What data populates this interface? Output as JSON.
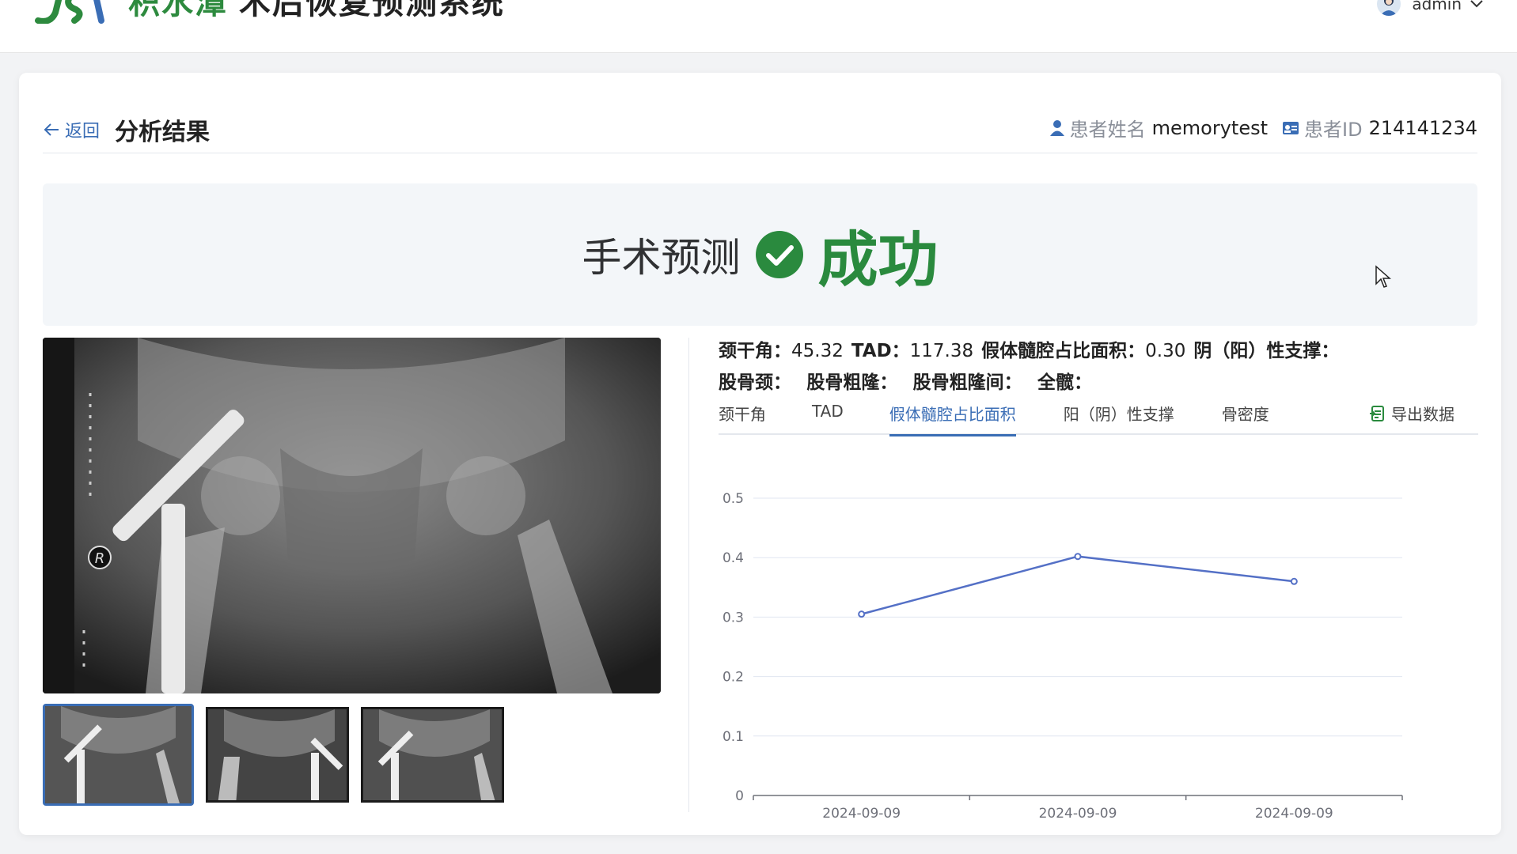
{
  "header": {
    "brand_name": "积水潭",
    "app_name": "术后恢复预测系统",
    "username": "admin"
  },
  "card": {
    "back_label": "返回",
    "page_title": "分析结果",
    "patient_name_label": "患者姓名",
    "patient_name": "memorytest",
    "patient_id_label": "患者ID",
    "patient_id": "214141234"
  },
  "result": {
    "label": "手术预测",
    "value": "成功",
    "status_color": "#2a8a3e"
  },
  "metrics": {
    "neck_shaft_angle_label": "颈干角：",
    "neck_shaft_angle": "45.32",
    "tad_label": "TAD：",
    "tad": "117.38",
    "canal_ratio_label": "假体髓腔占比面积：",
    "canal_ratio": "0.30",
    "support_label": "阴（阳）性支撑：",
    "femoral_neck_label": "股骨颈：",
    "greater_trochanter_label": "股骨粗隆：",
    "intertrochanteric_label": "股骨粗隆间：",
    "full_hip_label": "全髋："
  },
  "tabs": [
    {
      "label": "颈干角",
      "active": false
    },
    {
      "label": "TAD",
      "active": false
    },
    {
      "label": "假体髓腔占比面积",
      "active": true
    },
    {
      "label": "阳（阴）性支撑",
      "active": false
    },
    {
      "label": "骨密度",
      "active": false
    }
  ],
  "export_label": "导出数据",
  "images": {
    "main_label": "R",
    "thumbnail_count": 3,
    "selected_index": 0
  },
  "chart_data": {
    "type": "line",
    "categories": [
      "2024-09-09",
      "2024-09-09",
      "2024-09-09"
    ],
    "values": [
      0.305,
      0.402,
      0.36
    ],
    "yticks": [
      0,
      0.1,
      0.2,
      0.3,
      0.4,
      0.5
    ],
    "ylim": [
      0,
      0.5
    ],
    "title": "",
    "xlabel": "",
    "ylabel": "",
    "grid": true,
    "line_color": "#5470c6"
  }
}
